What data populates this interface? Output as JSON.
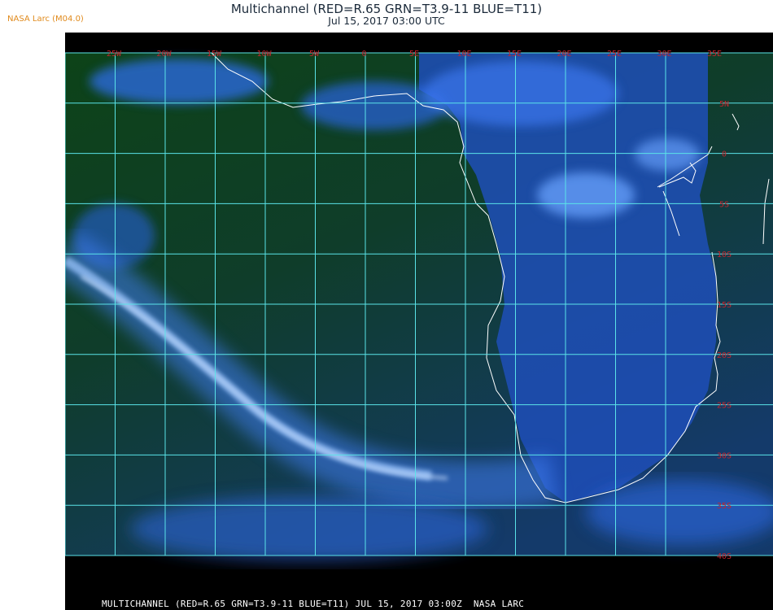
{
  "header": {
    "badge": "NASA Larc (M04.0)",
    "title": "Multichannel (RED=R.65 GRN=T3.9-11 BLUE=T11)",
    "subtitle": "Jul 15, 2017 03:00 UTC"
  },
  "footer": {
    "text": "MULTICHANNEL (RED=R.65 GRN=T3.9-11 BLUE=T11) JUL 15, 2017 03:00Z  NASA LARC"
  },
  "map": {
    "longitude_labels": [
      "25W",
      "20W",
      "15W",
      "10W",
      "5W",
      "0",
      "5E",
      "10E",
      "15E",
      "20E",
      "25E",
      "30E",
      "35E"
    ],
    "latitude_labels": [
      "5N",
      "0",
      "5S",
      "10S",
      "15S",
      "20S",
      "25S",
      "30S",
      "35S",
      "40S"
    ],
    "colors": {
      "ocean_dark": "#0c3f16",
      "cloud_blue": "#1d5ce0",
      "cloud_light": "#7fb6ff",
      "grid": "#5ae3e8",
      "coast": "#ffffff",
      "label": "#c4242c"
    }
  }
}
